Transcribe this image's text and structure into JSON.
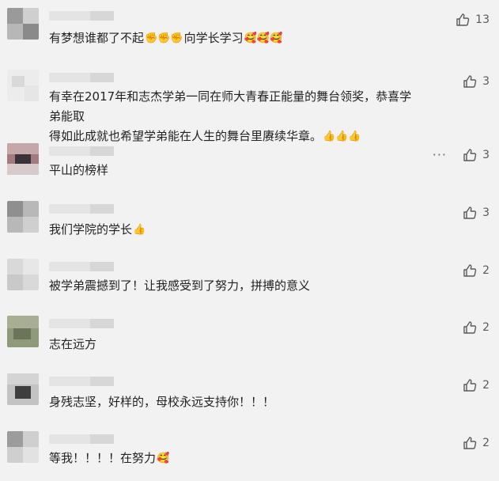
{
  "comments": [
    {
      "text": "有梦想谁都了不起",
      "emoji_after_text": "✊✊✊",
      "text2": "向学长学习",
      "emoji_end": "🥰🥰🥰",
      "likes": "13",
      "emoji_names": [
        "fist-emoji",
        "smile-emoji"
      ]
    },
    {
      "text_line1": "有幸在2017年和志杰学弟一同在师大青春正能量的舞台领奖，恭喜学弟能取",
      "text_line2": "得如此成就也希望学弟能在人生的舞台里赓续华章。",
      "emoji_end": "👍👍👍",
      "likes": "3"
    },
    {
      "text": "平山的榜样",
      "likes": "3",
      "more": "···"
    },
    {
      "text": "我们学院的学长",
      "emoji_end": "👍",
      "likes": "3"
    },
    {
      "text": "被学弟震撼到了！让我感受到了努力，拼搏的意义",
      "likes": "2"
    },
    {
      "text": "志在远方",
      "likes": "2"
    },
    {
      "text": "身残志坚，好样的，母校永远支持你！！！",
      "likes": "2"
    },
    {
      "text": "等我！！！！在努力",
      "emoji_end": "🥰",
      "likes": "2"
    }
  ],
  "icons": {
    "like": "thumbs-up-outline-icon",
    "more": "more-dots-icon"
  },
  "colors": {
    "background": "#f2f2f2",
    "text": "#222222",
    "icon": "#5a5a5a",
    "emoji": "#f5b400"
  }
}
